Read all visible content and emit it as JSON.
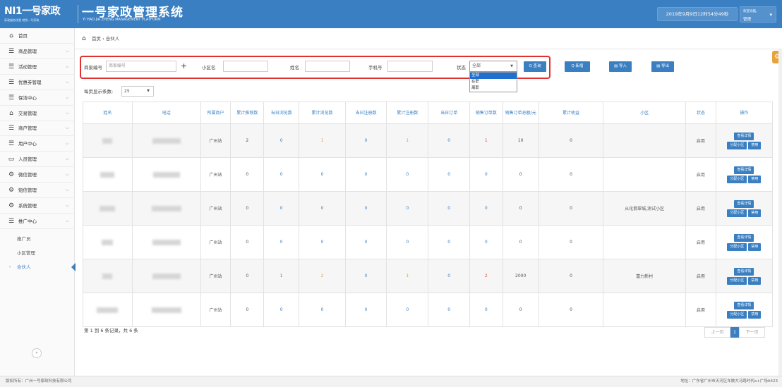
{
  "header": {
    "logo_brand": "NI1一号家政",
    "logo_sub": "家政服务找我 就找一号家政",
    "system_title": "一号家政管理系统",
    "system_subtitle": "YI HAO JIA ZHENG MANAGEMENT PLATFORM",
    "datetime": "2019年9月9日12时54分49秒",
    "welcome": "欢迎光临，",
    "username": "管理"
  },
  "sidebar": {
    "items": [
      {
        "label": "首页",
        "icon": "home-icon",
        "chevron": false
      },
      {
        "label": "商品管理",
        "icon": "list-icon",
        "chevron": true
      },
      {
        "label": "活动管理",
        "icon": "list-icon",
        "chevron": true
      },
      {
        "label": "优惠券管理",
        "icon": "list-icon",
        "chevron": true
      },
      {
        "label": "保洁中心",
        "icon": "list-icon",
        "chevron": true
      },
      {
        "label": "交易管理",
        "icon": "home-icon",
        "chevron": true
      },
      {
        "label": "商户管理",
        "icon": "list-icon",
        "chevron": true
      },
      {
        "label": "用户中心",
        "icon": "list-icon",
        "chevron": true
      },
      {
        "label": "人员管理",
        "icon": "monitor-icon",
        "chevron": true
      },
      {
        "label": "微信管理",
        "icon": "cogs-icon",
        "chevron": true
      },
      {
        "label": "短信管理",
        "icon": "cogs-icon",
        "chevron": true
      },
      {
        "label": "系统管理",
        "icon": "cogs-icon",
        "chevron": true
      },
      {
        "label": "推广中心",
        "icon": "list-icon",
        "chevron": true
      }
    ],
    "subitems": [
      {
        "label": "推广员",
        "active": false
      },
      {
        "label": "小区管理",
        "active": false
      },
      {
        "label": "合伙人",
        "active": true
      }
    ],
    "collapse_symbol": "«"
  },
  "breadcrumb": {
    "text": "首页 › 合伙人"
  },
  "search": {
    "merchant_label": "商家编号",
    "merchant_placeholder": "商家编号",
    "community_label": "小区名",
    "name_label": "姓名",
    "phone_label": "手机号",
    "status_label": "状态",
    "status_value": "全部",
    "status_options": [
      "全部",
      "在职",
      "离职"
    ],
    "query_button": "Q 查询",
    "add_button": "Q 新增",
    "import_button": "导入",
    "export_button": "导出"
  },
  "page_size": {
    "label": "每页显示条数:",
    "value": "25"
  },
  "table": {
    "headers": [
      "姓名",
      "电话",
      "所属商户",
      "累计推荐数",
      "当日浏览数",
      "累计浏览数",
      "当日注册数",
      "累计注册数",
      "当日订单",
      "销售订单数",
      "销售订单总额/元",
      "累计收益",
      "小区",
      "状态",
      "操作"
    ],
    "rows": [
      {
        "merchant": "广州站",
        "total_referrals": "2",
        "today_views": "0",
        "total_views": "1",
        "today_regs": "0",
        "total_regs": "1",
        "today_orders": "0",
        "sales_orders": "1",
        "sales_amount": "10",
        "total_income": "0",
        "community": "",
        "status": "启用"
      },
      {
        "merchant": "广州站",
        "total_referrals": "0",
        "today_views": "0",
        "total_views": "0",
        "today_regs": "0",
        "total_regs": "0",
        "today_orders": "0",
        "sales_orders": "0",
        "sales_amount": "0",
        "total_income": "0",
        "community": "",
        "status": "启用"
      },
      {
        "merchant": "广州站",
        "total_referrals": "0",
        "today_views": "0",
        "total_views": "0",
        "today_regs": "0",
        "total_regs": "0",
        "today_orders": "0",
        "sales_orders": "0",
        "sales_amount": "0",
        "total_income": "0",
        "community": "从化翡翠城,测试小区",
        "status": "启用"
      },
      {
        "merchant": "广州站",
        "total_referrals": "0",
        "today_views": "0",
        "total_views": "0",
        "today_regs": "0",
        "total_regs": "0",
        "today_orders": "0",
        "sales_orders": "0",
        "sales_amount": "0",
        "total_income": "0",
        "community": "",
        "status": "启用"
      },
      {
        "merchant": "广州站",
        "total_referrals": "0",
        "today_views": "1",
        "total_views": "2",
        "today_regs": "0",
        "total_regs": "1",
        "today_orders": "0",
        "sales_orders": "2",
        "sales_amount": "2000",
        "total_income": "0",
        "community": "富力新村",
        "status": "启用"
      },
      {
        "merchant": "广州站",
        "total_referrals": "0",
        "today_views": "0",
        "total_views": "0",
        "today_regs": "0",
        "total_regs": "0",
        "today_orders": "0",
        "sales_orders": "0",
        "sales_amount": "0",
        "total_income": "0",
        "community": "",
        "status": "启用"
      }
    ],
    "actions": {
      "detail": "查看详情",
      "assign": "分配小区",
      "disable": "禁用"
    }
  },
  "summary": "第 1 到 6 条记录，共 6 条",
  "pager": {
    "prev": "上一页",
    "current": "1",
    "next": "下一页"
  },
  "footer": {
    "copyright": "版权所有：广州一号家政科技有限公司",
    "address": "地址：广东省广州市天河区车陂大马路时代e+广场A423"
  },
  "colors": {
    "header_bg": "#3a7fc2",
    "accent": "#3a7fc2",
    "highlight_frame": "#e03030",
    "orange": "#e8a23c",
    "red": "#e04e3a"
  }
}
